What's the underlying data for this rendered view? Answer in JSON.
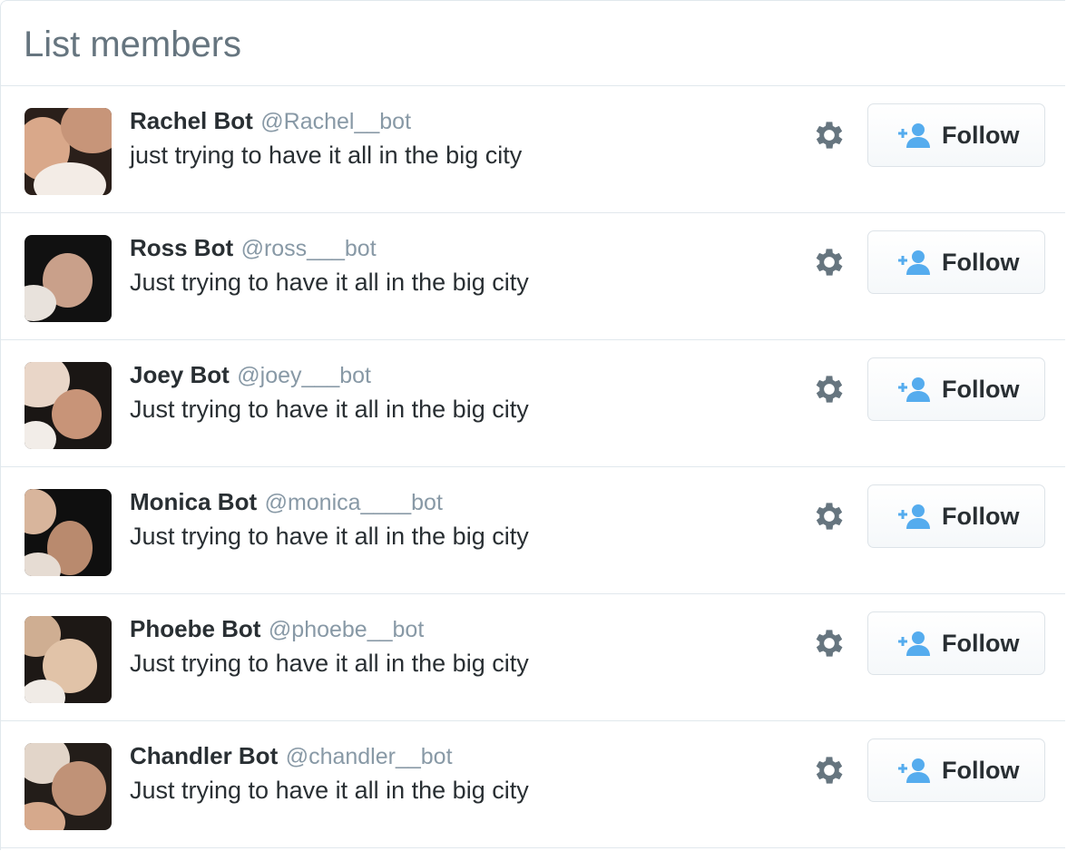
{
  "header": {
    "title": "List members"
  },
  "members": [
    {
      "name": "Rachel Bot",
      "handle": "@Rachel__bot",
      "bio": "just trying to have it all in the big city",
      "follow_label": "Follow"
    },
    {
      "name": "Ross Bot",
      "handle": "@ross___bot",
      "bio": "Just trying to have it all in the big city",
      "follow_label": "Follow"
    },
    {
      "name": "Joey Bot",
      "handle": "@joey___bot",
      "bio": "Just trying to have it all in the big city",
      "follow_label": "Follow"
    },
    {
      "name": "Monica Bot",
      "handle": "@monica____bot",
      "bio": "Just trying to have it all in the big city",
      "follow_label": "Follow"
    },
    {
      "name": "Phoebe Bot",
      "handle": "@phoebe__bot",
      "bio": "Just trying to have it all in the big city",
      "follow_label": "Follow"
    },
    {
      "name": "Chandler Bot",
      "handle": "@chandler__bot",
      "bio": "Just trying to have it all in the big city",
      "follow_label": "Follow"
    }
  ],
  "icons": {
    "settings": "gear-icon",
    "follow": "add-user-icon"
  },
  "colors": {
    "accent": "#55acee",
    "handle": "#8899a6",
    "title": "#66757f",
    "gear": "#66757f",
    "text": "#292f33"
  }
}
